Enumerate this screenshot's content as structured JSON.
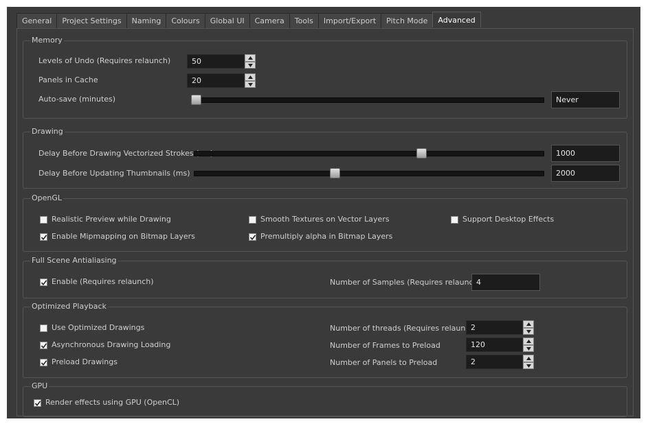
{
  "tabs": [
    "General",
    "Project Settings",
    "Naming",
    "Colours",
    "Global UI",
    "Camera",
    "Tools",
    "Import/Export",
    "Pitch Mode",
    "Advanced"
  ],
  "active_tab": "Advanced",
  "memory": {
    "title": "Memory",
    "undo_label": "Levels of Undo (Requires relaunch)",
    "undo_value": "50",
    "panels_label": "Panels in Cache",
    "panels_value": "20",
    "autosave_label": "Auto-save (minutes)",
    "autosave_value": "Never",
    "autosave_slider_fraction": 0.0
  },
  "drawing": {
    "title": "Drawing",
    "delay_strokes_label": "Delay Before Drawing Vectorized Strokes (ms)",
    "delay_strokes_value": "1000",
    "delay_strokes_fraction": 0.655,
    "delay_thumbs_label": "Delay Before Updating Thumbnails (ms)",
    "delay_thumbs_value": "2000",
    "delay_thumbs_fraction": 0.4
  },
  "opengl": {
    "title": "OpenGL",
    "realistic_preview": {
      "label": "Realistic Preview while Drawing",
      "checked": false
    },
    "smooth_textures": {
      "label": "Smooth Textures on Vector Layers",
      "checked": false
    },
    "desktop_effects": {
      "label": "Support Desktop Effects",
      "checked": false
    },
    "mipmapping": {
      "label": "Enable Mipmapping on Bitmap Layers",
      "checked": true
    },
    "premultiply": {
      "label": "Premultiply alpha in Bitmap Layers",
      "checked": true
    }
  },
  "antialiasing": {
    "title": "Full Scene Antialiasing",
    "enable": {
      "label": "Enable (Requires relaunch)",
      "checked": true
    },
    "samples_label": "Number of Samples (Requires relaunch)",
    "samples_value": "4"
  },
  "playback": {
    "title": "Optimized Playback",
    "use_optimized": {
      "label": "Use Optimized Drawings",
      "checked": false
    },
    "async_loading": {
      "label": "Asynchronous Drawing Loading",
      "checked": true
    },
    "preload": {
      "label": "Preload Drawings",
      "checked": true
    },
    "threads_label": "Number of threads (Requires relaunch)",
    "threads_value": "2",
    "frames_label": "Number of Frames to Preload",
    "frames_value": "120",
    "panels_label": "Number of Panels to Preload",
    "panels_value": "2"
  },
  "gpu": {
    "title": "GPU",
    "render_gpu": {
      "label": "Render effects using GPU (OpenCL)",
      "checked": true
    }
  }
}
